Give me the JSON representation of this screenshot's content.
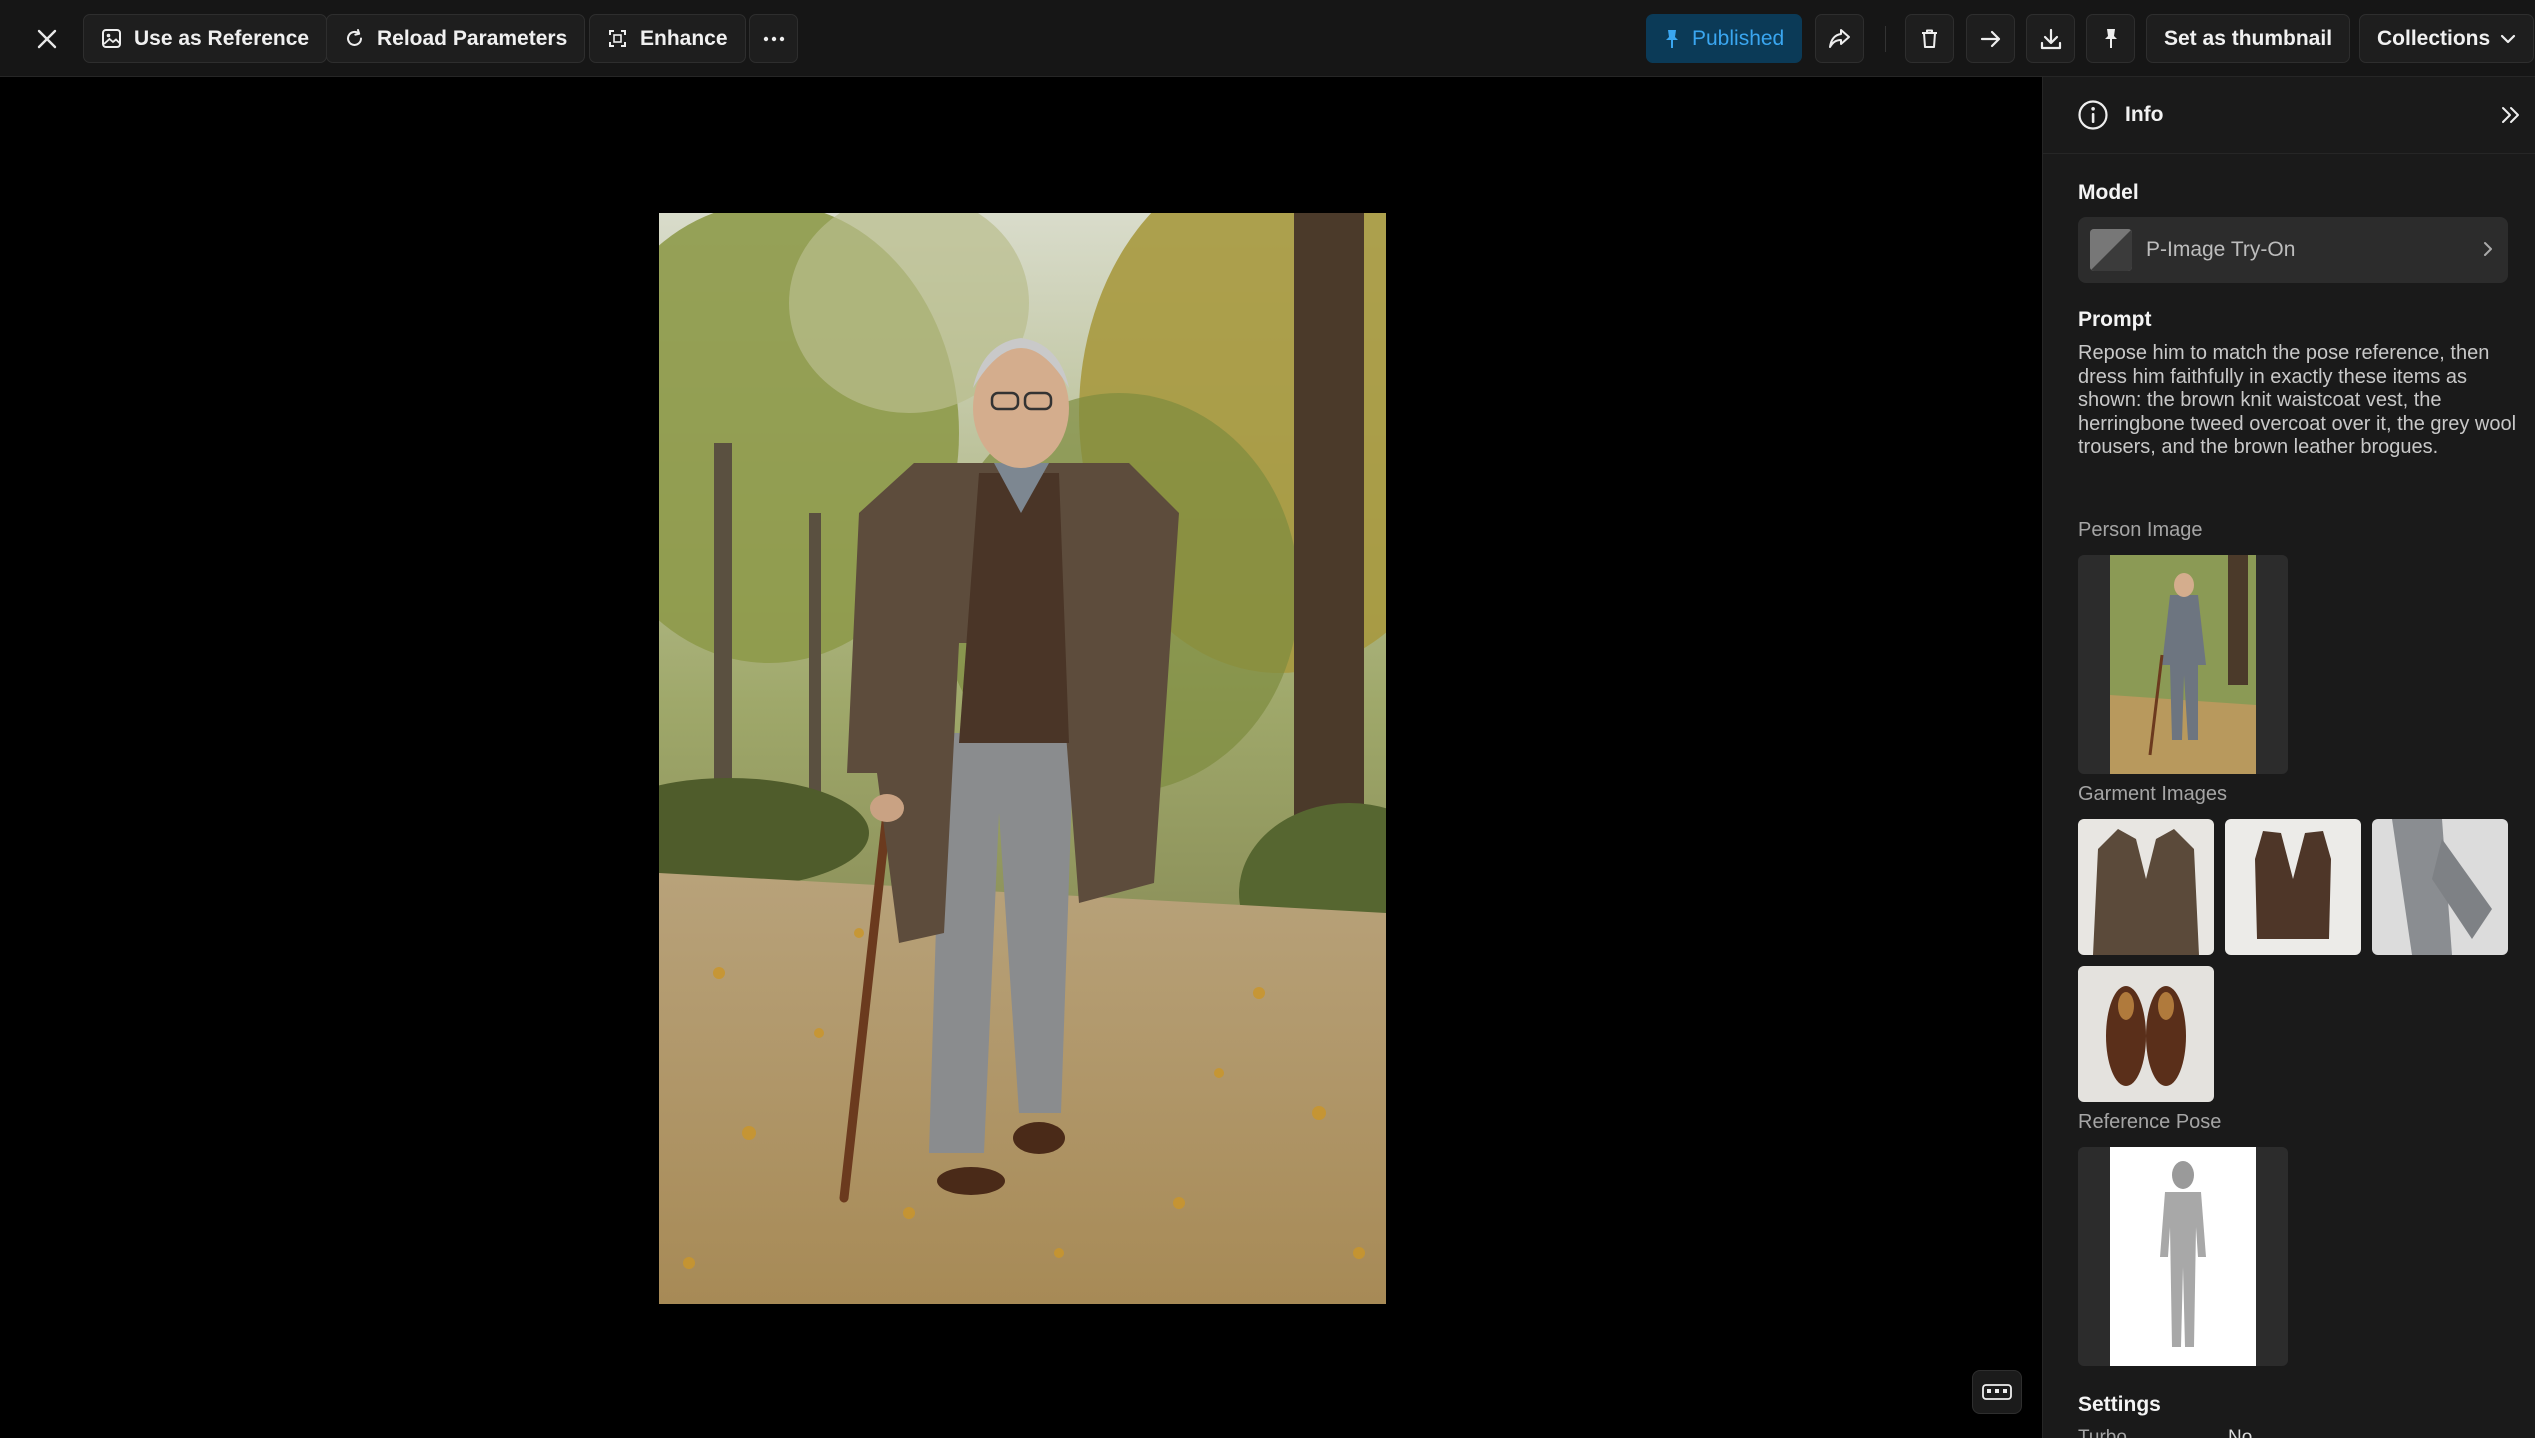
{
  "toolbar": {
    "close_icon": "close-icon",
    "use_as_reference": "Use as Reference",
    "reload_parameters": "Reload Parameters",
    "enhance": "Enhance",
    "more_icon": "more-horizontal-icon",
    "published": "Published",
    "share_icon": "share-icon",
    "delete_icon": "trash-icon",
    "next_icon": "arrow-right-icon",
    "download_icon": "download-icon",
    "pin_icon": "pin-icon",
    "set_thumbnail": "Set as thumbnail",
    "collections": "Collections"
  },
  "viewer": {
    "tool_icon": "keyboard-icon"
  },
  "panel": {
    "title": "Info",
    "model_label": "Model",
    "model_name": "P-Image Try-On",
    "prompt_label": "Prompt",
    "prompt_text": "Repose him to match the pose reference, then dress him faithfully in exactly these items as shown: the brown knit waistcoat vest, the herringbone tweed overcoat over it, the grey wool trousers, and the brown leather brogues.",
    "person_image_label": "Person Image",
    "garment_images_label": "Garment Images",
    "reference_pose_label": "Reference Pose",
    "settings_label": "Settings",
    "settings_row_label": "Turbo",
    "settings_row_value": "No"
  },
  "colors": {
    "accent": "#3aa6f0",
    "published_bg": "#0b3a57",
    "panel_bg": "#1a1a1a",
    "toolbar_bg": "#161616"
  }
}
